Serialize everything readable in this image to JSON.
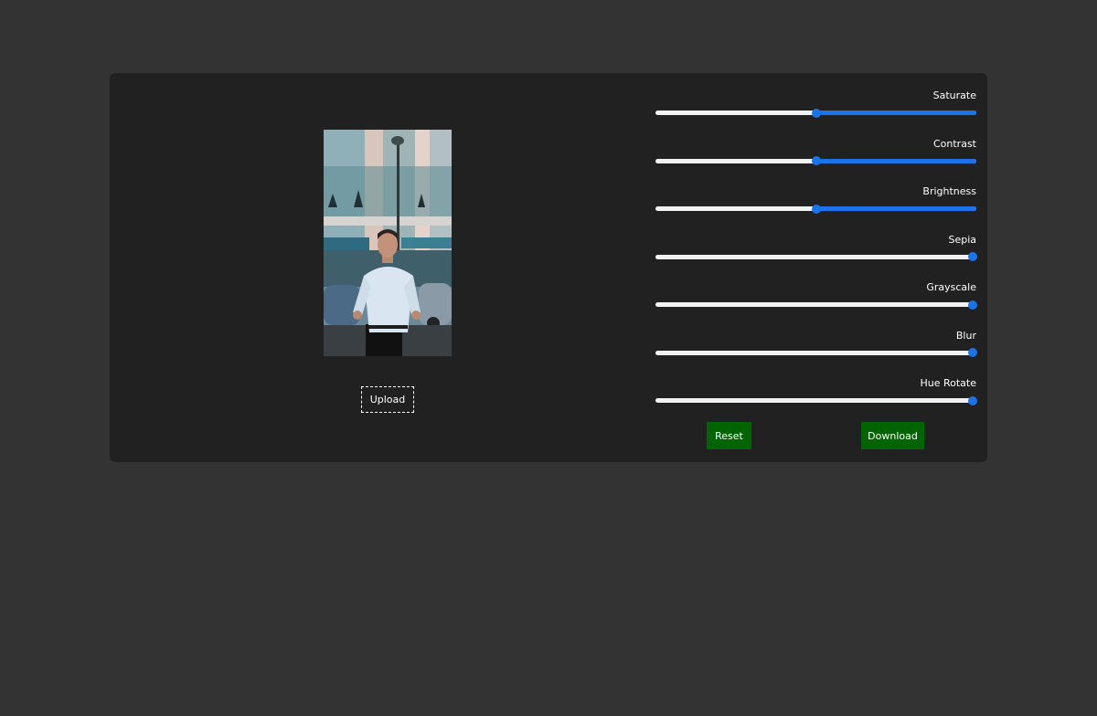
{
  "image": {
    "alt": ""
  },
  "upload": {
    "label": "Upload"
  },
  "sliders": [
    {
      "label": "Saturate",
      "level": 0.5
    },
    {
      "label": "Contrast",
      "level": 0.5
    },
    {
      "label": "Brightness",
      "level": 0.5
    },
    {
      "label": "Sepia",
      "level": 0.99
    },
    {
      "label": "Grayscale",
      "level": 0.99
    },
    {
      "label": "Blur",
      "level": 0.99
    },
    {
      "label": "Hue Rotate",
      "level": 0.99
    }
  ],
  "buttons": {
    "reset": "Reset",
    "download": "Download"
  },
  "colors": {
    "page_bg": "#333333",
    "card_bg": "#212121",
    "accent": "#1a73e8",
    "button_bg": "#006400"
  }
}
